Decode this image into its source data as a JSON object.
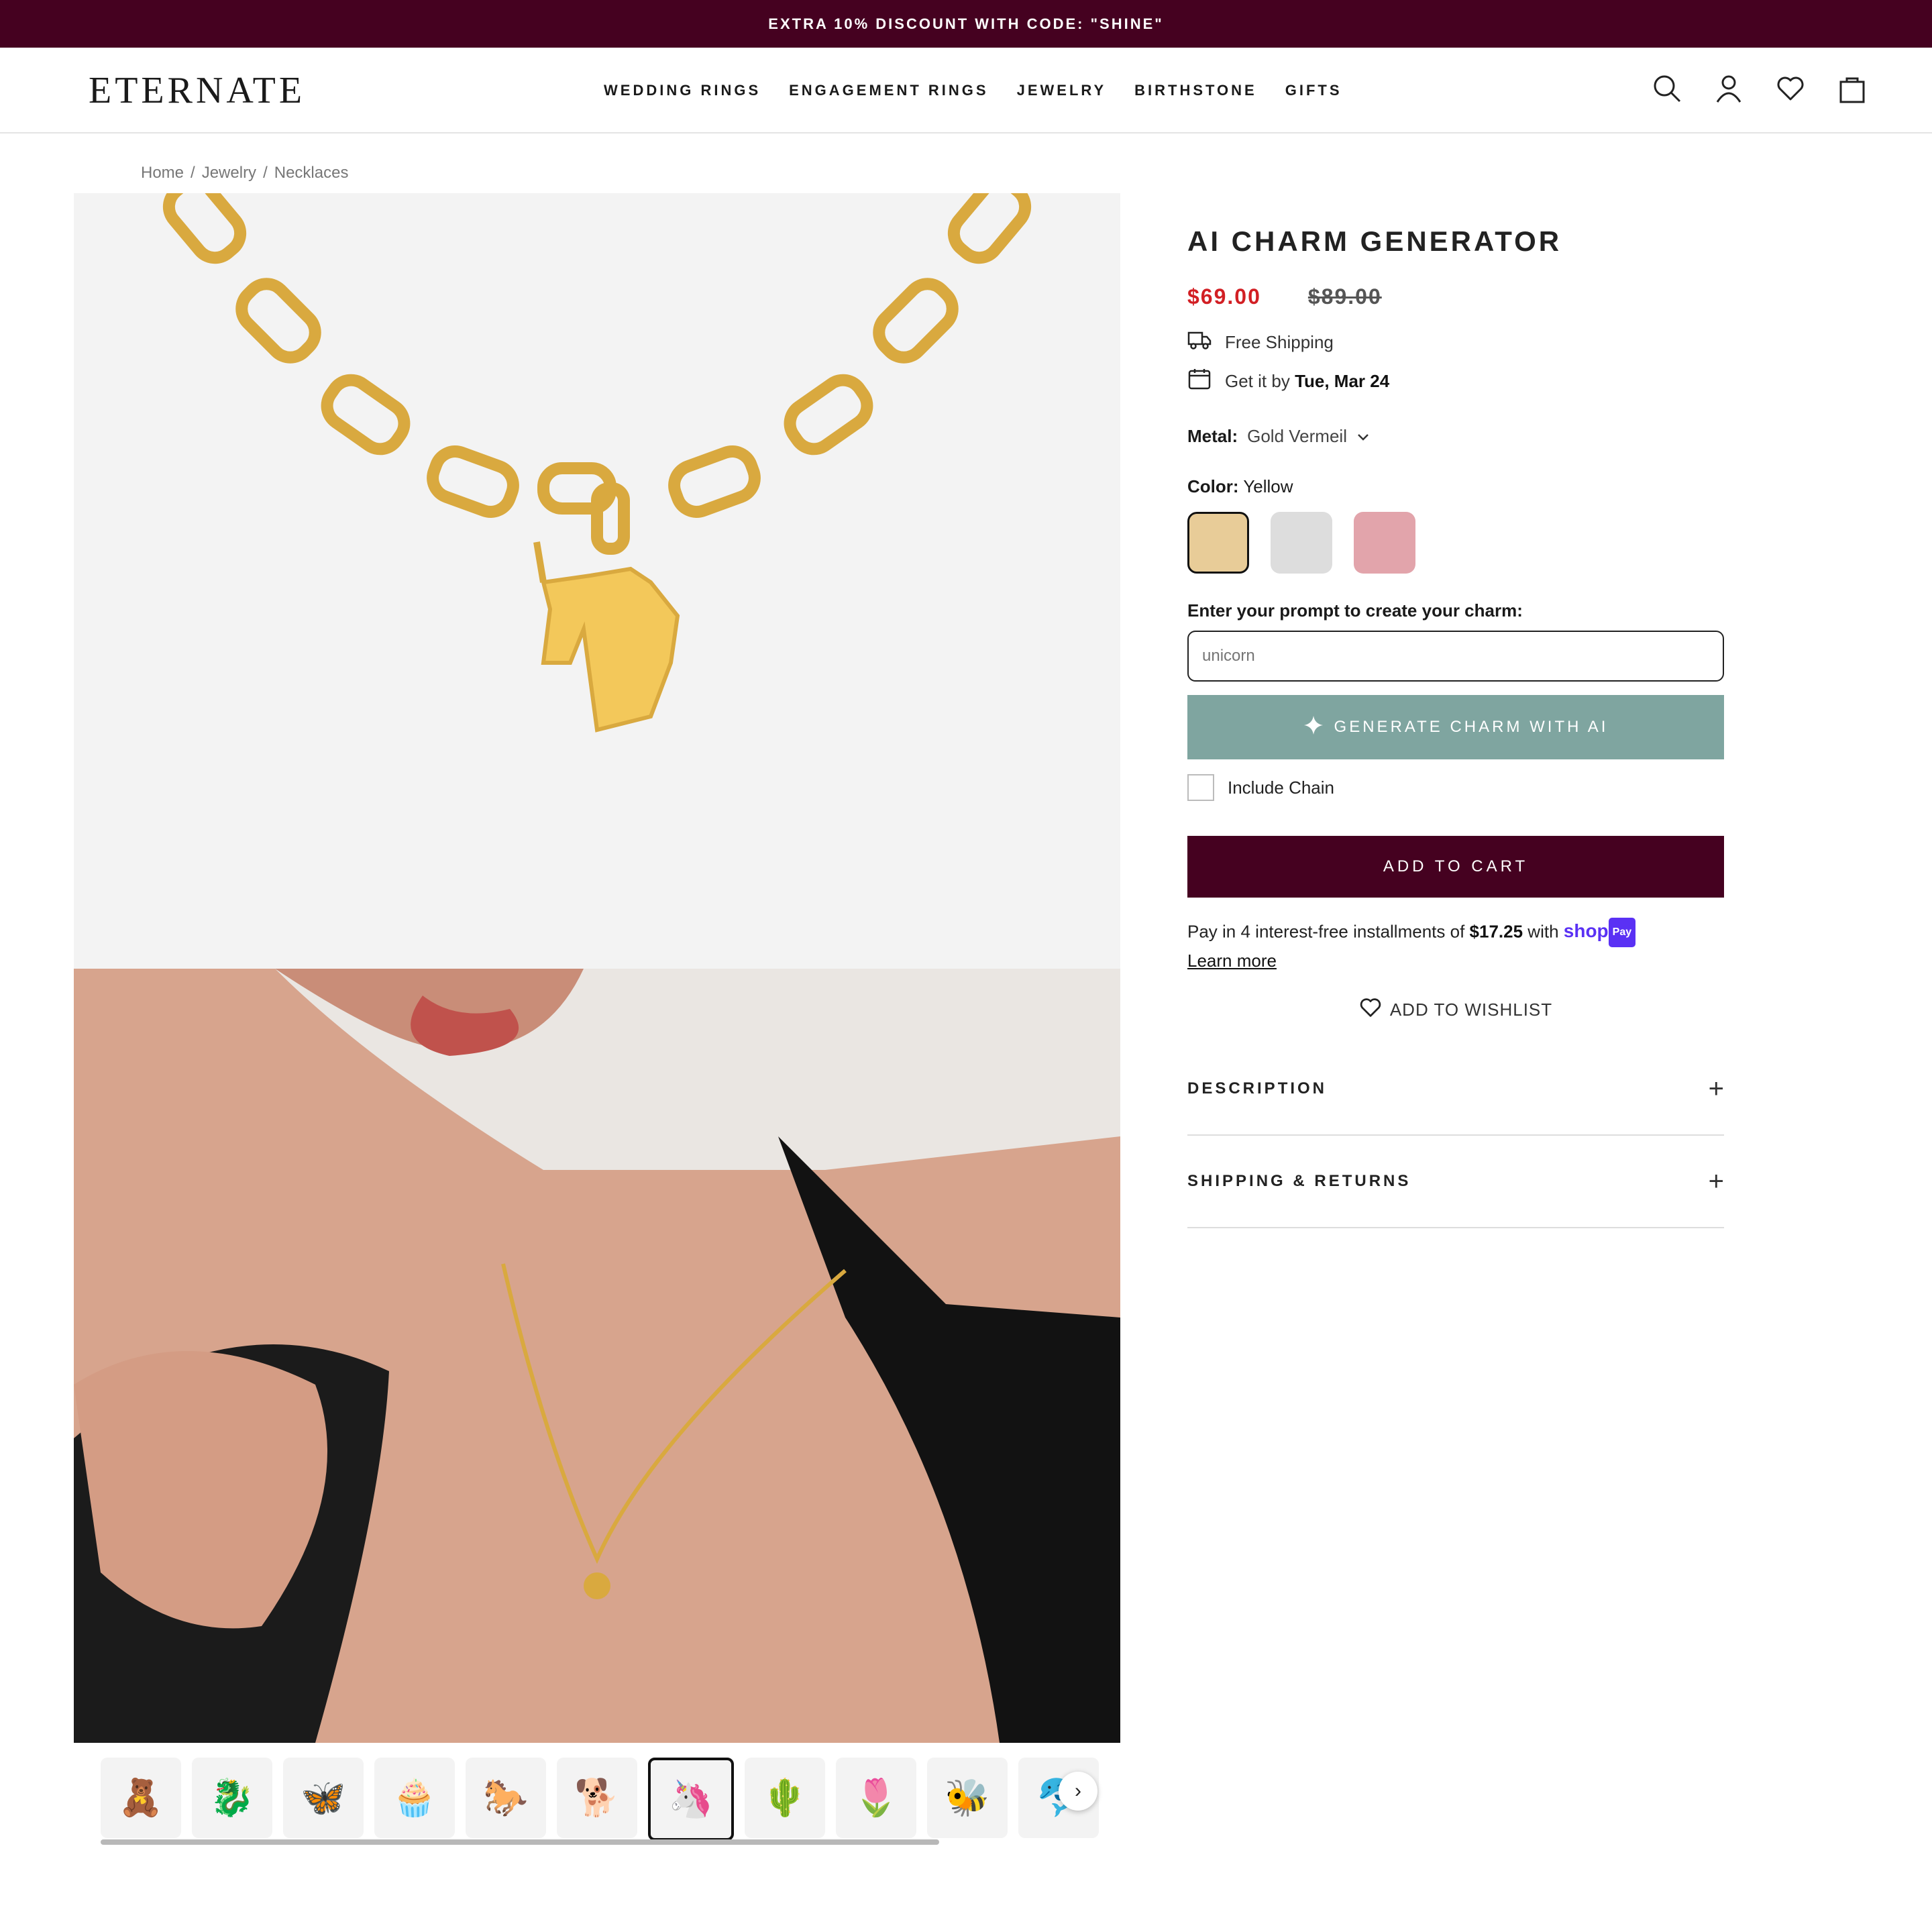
{
  "promo": {
    "text": "EXTRA 10% DISCOUNT WITH CODE: \"SHINE\""
  },
  "header": {
    "logo": "ETERNATE",
    "nav": [
      "WEDDING RINGS",
      "ENGAGEMENT RINGS",
      "JEWELRY",
      "BIRTHSTONE",
      "GIFTS"
    ],
    "icons": [
      "search-icon",
      "account-icon",
      "heart-icon",
      "bag-icon"
    ]
  },
  "breadcrumb": {
    "items": [
      "Home",
      "Jewelry",
      "Necklaces"
    ]
  },
  "gallery": {
    "thumbnails": [
      "teddy-bear",
      "dragon",
      "letter-a-butterfly",
      "cupcake",
      "horse",
      "dog",
      "unicorn",
      "cactus",
      "tulip",
      "bee",
      "dolphin"
    ],
    "active_index": 6
  },
  "product": {
    "title": "AI CHARM GENERATOR",
    "price_now": "$69.00",
    "price_old": "$89.00",
    "shipping": "Free Shipping",
    "delivery_prefix": "Get it by",
    "delivery_date": "Tue, Mar 24",
    "metal_label": "Metal:",
    "metal_value": "Gold Vermeil",
    "color_label": "Color:",
    "color_value": "Yellow",
    "swatches": [
      "#e8cc98",
      "#dddddd",
      "#e2a4ab"
    ],
    "prompt_label": "Enter your prompt to create your charm:",
    "prompt_placeholder": "unicorn",
    "generate_label": "GENERATE CHARM WITH AI",
    "include_chain": "Include Chain",
    "add_to_cart": "ADD TO CART",
    "installments_prefix": "Pay in 4 interest-free installments of",
    "installments_amount": "$17.25",
    "installments_with": "with",
    "shop_label": "shop",
    "pay_label": "Pay",
    "learn_more": "Learn more",
    "wishlist": "ADD TO WISHLIST",
    "accordion": [
      "DESCRIPTION",
      "SHIPPING & RETURNS"
    ]
  },
  "colors": {
    "brand": "#450120",
    "accent": "#7fa5a0",
    "sale": "#d21f24"
  }
}
